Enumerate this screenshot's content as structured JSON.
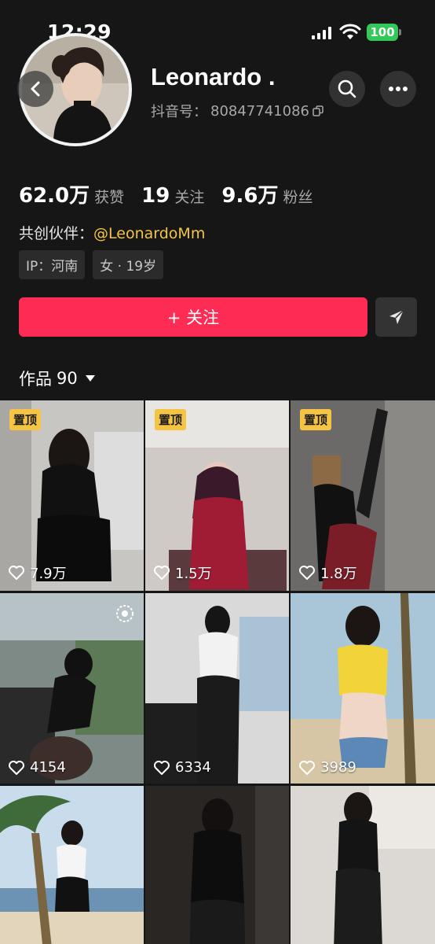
{
  "status": {
    "time": "12:29",
    "battery": "100"
  },
  "profile": {
    "name": "Leonardo .",
    "id_label": "抖音号：",
    "id_value": "80847741086"
  },
  "stats": [
    {
      "num": "62.0万",
      "label": "获赞"
    },
    {
      "num": "19",
      "label": "关注"
    },
    {
      "num": "9.6万",
      "label": "粉丝"
    }
  ],
  "partner": {
    "label": "共创伙伴：",
    "handle": "@LeonardoMm"
  },
  "tags": [
    "IP：河南",
    "女 · 19岁"
  ],
  "follow_label": "+ 关注",
  "works": {
    "label": "作品",
    "count": "90"
  },
  "pin_label": "置顶",
  "videos": [
    {
      "likes": "7.9万",
      "pinned": true
    },
    {
      "likes": "1.5万",
      "pinned": true
    },
    {
      "likes": "1.8万",
      "pinned": true
    },
    {
      "likes": "4154",
      "pinned": false
    },
    {
      "likes": "6334",
      "pinned": false
    },
    {
      "likes": "3989",
      "pinned": false
    },
    {
      "likes": "",
      "pinned": false
    },
    {
      "likes": "",
      "pinned": false
    },
    {
      "likes": "",
      "pinned": false
    }
  ],
  "colors": {
    "accent": "#fe2c55",
    "pin": "#f5c443",
    "background": "#161616"
  },
  "icons": [
    "back-icon",
    "search-icon",
    "more-icon",
    "copy-icon",
    "share-icon",
    "heart-icon",
    "live-icon",
    "caret-down-icon"
  ]
}
